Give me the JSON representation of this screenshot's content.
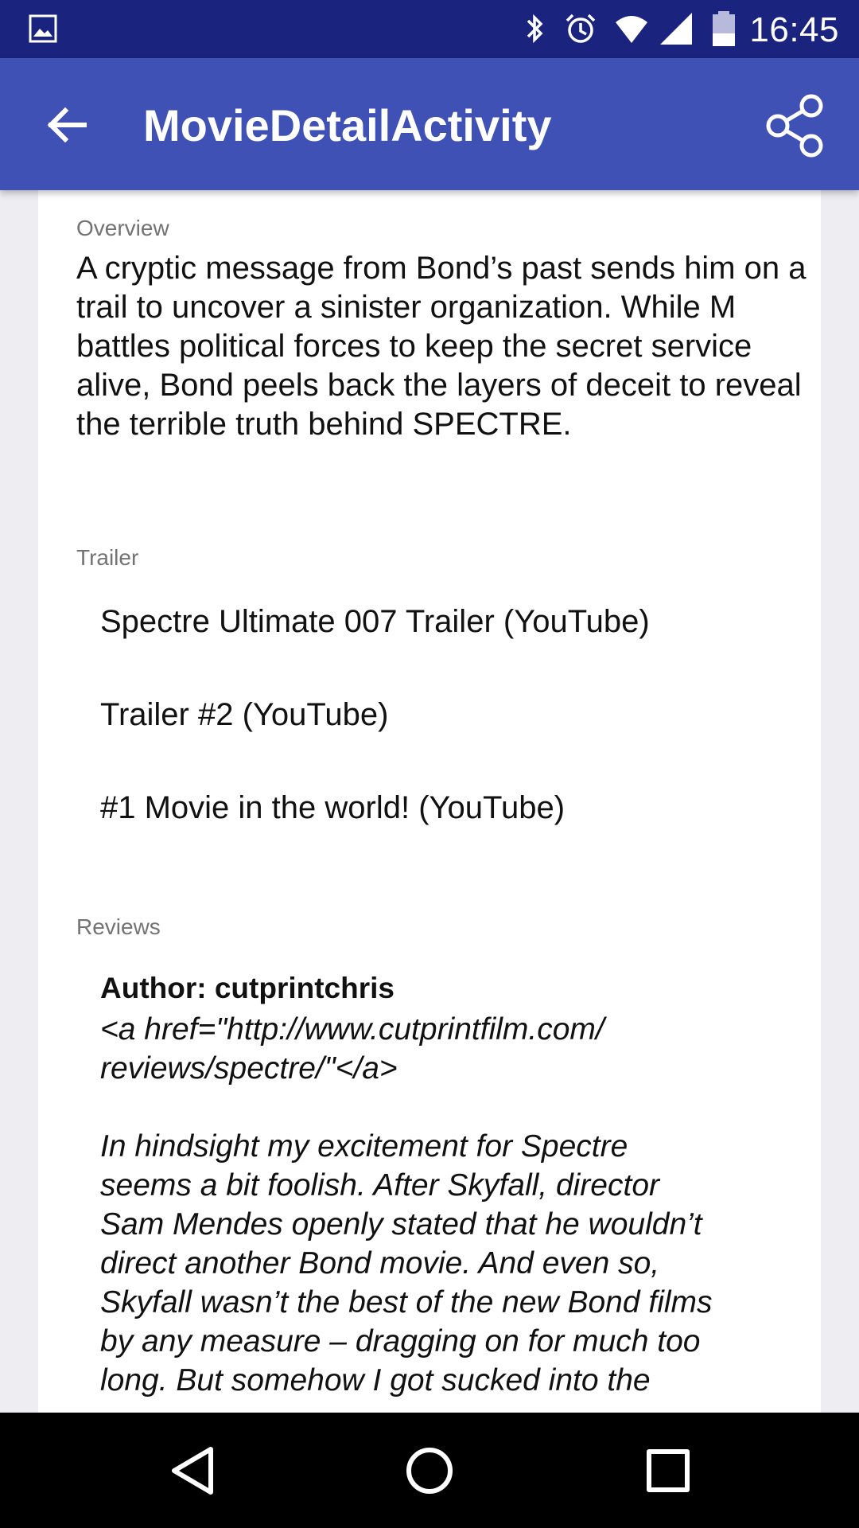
{
  "status_bar": {
    "time": "16:45",
    "left_icons": [
      "gallery-icon"
    ],
    "right_icons": [
      "bluetooth-icon",
      "alarm-icon",
      "wifi-icon",
      "cell-signal-icon",
      "battery-icon"
    ],
    "background": "#1a237e"
  },
  "app_bar": {
    "title": "MovieDetailActivity",
    "back_icon": "arrow-back-icon",
    "share_icon": "share-icon",
    "background": "#3f51b5"
  },
  "overview": {
    "label": "Overview",
    "text": "A cryptic message from Bond’s past sends him on a trail to uncover a sinister organization. While M battles political forces to keep the secret service alive, Bond peels back the layers of deceit to reveal the terrible truth behind SPECTRE."
  },
  "trailers": {
    "label": "Trailer",
    "items": [
      "Spectre Ultimate 007 Trailer (YouTube)",
      "Trailer #2 (YouTube)",
      "#1 Movie in the world! (YouTube)"
    ]
  },
  "reviews": {
    "label": "Reviews",
    "items": [
      {
        "author": "Author: cutprintchris",
        "text": "<a href=\"http://www.cutprintfilm.com/\nreviews/spectre/\"</a>\n\nIn hindsight my excitement for Spectre\nseems a bit foolish. After Skyfall, director\nSam Mendes openly stated that he wouldn’t\ndirect another Bond movie. And even so,\nSkyfall wasn’t the best of the new Bond films\nby any measure – dragging on for much too\nlong. But somehow I got sucked into the"
      }
    ]
  },
  "nav_bar": {
    "buttons": [
      "back-triangle-icon",
      "home-circle-icon",
      "recents-square-icon"
    ]
  }
}
